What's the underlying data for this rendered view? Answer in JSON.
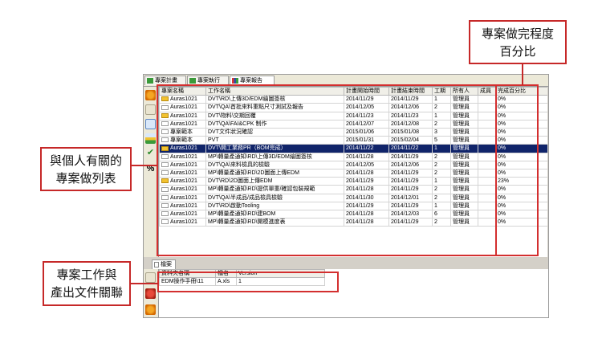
{
  "tabs": [
    {
      "label": "專案計畫",
      "color": "#3a9a3a"
    },
    {
      "label": "專案執行",
      "color": "#3a9a3a"
    },
    {
      "label": "專案報告",
      "color": "#2850a8"
    }
  ],
  "task_table": {
    "columns": [
      "專案名稱",
      "工作名稱",
      "計畫開始時間",
      "計畫結束時間",
      "工期",
      "所有人",
      "成員",
      "完成百分比"
    ],
    "rows": [
      {
        "flag": "yellow",
        "project": "Auras1021",
        "task": "DVT\\RD\\上傳3D/EDM繪圖簽核",
        "start": "2014/11/29",
        "end": "2014/11/29",
        "duration": "1",
        "owner": "管理員",
        "member": "",
        "percent": "0%"
      },
      {
        "flag": "white",
        "project": "Auras1021",
        "task": "DVT\\QA\\首批來料重點尺寸測試及報告",
        "start": "2014/12/05",
        "end": "2014/12/06",
        "duration": "2",
        "owner": "管理員",
        "member": "",
        "percent": "0%"
      },
      {
        "flag": "yellow",
        "project": "Auras1021",
        "task": "DVT\\物料\\交期回覆",
        "start": "2014/11/23",
        "end": "2014/11/23",
        "duration": "1",
        "owner": "管理員",
        "member": "",
        "percent": "0%"
      },
      {
        "flag": "white",
        "project": "Auras1021",
        "task": "DVT\\QA\\FAI&CPK 制作",
        "start": "2014/12/07",
        "end": "2014/12/08",
        "duration": "2",
        "owner": "管理員",
        "member": "",
        "percent": "0%"
      },
      {
        "flag": "white",
        "project": "專案範本",
        "task": "DVT文件狀況確認",
        "start": "2015/01/06",
        "end": "2015/01/08",
        "duration": "3",
        "owner": "管理員",
        "member": "",
        "percent": "0%"
      },
      {
        "flag": "white",
        "project": "專案範本",
        "task": "PVT",
        "start": "2015/01/31",
        "end": "2015/02/04",
        "duration": "5",
        "owner": "管理員",
        "member": "",
        "percent": "0%"
      },
      {
        "flag": "yellow",
        "project": "Auras1021",
        "task": "DVT\\開工業務PR（BOM完成）",
        "start": "2014/11/22",
        "end": "2014/11/22",
        "duration": "1",
        "owner": "管理員",
        "member": "",
        "percent": "0%",
        "selected": true
      },
      {
        "flag": "white",
        "project": "Auras1021",
        "task": "MP\\轉量產通知\\RD\\上傳3D/EDM繪圖簽核",
        "start": "2014/11/28",
        "end": "2014/11/29",
        "duration": "2",
        "owner": "管理員",
        "member": "",
        "percent": "0%"
      },
      {
        "flag": "white",
        "project": "Auras1021",
        "task": "DVT\\QA\\來料檢具的檢驗",
        "start": "2014/12/05",
        "end": "2014/12/06",
        "duration": "2",
        "owner": "管理員",
        "member": "",
        "percent": "0%"
      },
      {
        "flag": "white",
        "project": "Auras1021",
        "task": "MP\\轉量產通知\\RD\\2D圖面上傳EDM",
        "start": "2014/11/28",
        "end": "2014/11/29",
        "duration": "2",
        "owner": "管理員",
        "member": "",
        "percent": "0%"
      },
      {
        "flag": "yellow",
        "project": "Auras1021",
        "task": "DVT\\RD\\2D圖面上傳EDM",
        "start": "2014/11/29",
        "end": "2014/11/29",
        "duration": "1",
        "owner": "管理員",
        "member": "",
        "percent": "23%"
      },
      {
        "flag": "white",
        "project": "Auras1021",
        "task": "MP\\轉量產通知\\RD\\提供單重/確認包裝規範",
        "start": "2014/11/28",
        "end": "2014/11/29",
        "duration": "2",
        "owner": "管理員",
        "member": "",
        "percent": "0%"
      },
      {
        "flag": "white",
        "project": "Auras1021",
        "task": "DVT\\QA\\半成品/成品檢具檢驗",
        "start": "2014/11/30",
        "end": "2014/12/01",
        "duration": "2",
        "owner": "管理員",
        "member": "",
        "percent": "0%"
      },
      {
        "flag": "white",
        "project": "Auras1021",
        "task": "DVT\\RD\\啟動Tooling",
        "start": "2014/11/29",
        "end": "2014/11/29",
        "duration": "1",
        "owner": "管理員",
        "member": "",
        "percent": "0%"
      },
      {
        "flag": "white",
        "project": "Auras1021",
        "task": "MP\\轉量產通知\\RD\\建BOM",
        "start": "2014/11/28",
        "end": "2014/12/03",
        "duration": "6",
        "owner": "管理員",
        "member": "",
        "percent": "0%"
      },
      {
        "flag": "white",
        "project": "Auras1021",
        "task": "MP\\轉量產通知\\RD\\開模進度表",
        "start": "2014/11/28",
        "end": "2014/11/29",
        "duration": "2",
        "owner": "管理員",
        "member": "",
        "percent": "0%"
      }
    ]
  },
  "bottom": {
    "tab_label": "檔案",
    "columns": [
      "資料夾名稱",
      "檔名",
      "Version"
    ],
    "rows": [
      {
        "folder": "EDM操作手冊\\11",
        "file": "A.xls",
        "version": "1"
      }
    ]
  },
  "annotations": {
    "percent": {
      "line1": "專案做完程度",
      "line2": "百分比"
    },
    "personal": {
      "line1": "與個人有關的",
      "line2": "專案做列表"
    },
    "files": {
      "line1": "專案工作與",
      "line2": "產出文件關聯"
    },
    "highlight_color": "#d32f2f"
  }
}
